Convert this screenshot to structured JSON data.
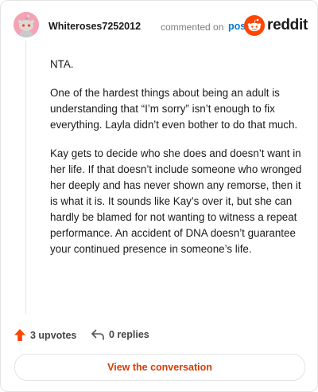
{
  "comment": {
    "username": "Whiteroses7252012",
    "action_text": "commented on",
    "post_link": "post",
    "paragraphs": [
      "NTA.",
      "One of the hardest things about being an adult is understanding that “I’m sorry” isn’t enough to fix everything. Layla didn’t even bother to do that much.",
      "Kay gets to decide who she does and doesn’t want in her life. If that doesn’t include someone who wronged her deeply and has never shown any remorse, then it is what it is. It sounds like Kay’s over it, but she can hardly be blamed for not wanting to witness a repeat performance. An accident of DNA doesn’t guarantee your continued presence in someone’s life."
    ]
  },
  "brand": {
    "wordmark": "reddit",
    "accent": "#ff4500",
    "link_color": "#0079d3"
  },
  "actions": {
    "upvotes": "3 upvotes",
    "replies": "0 replies"
  },
  "footer": {
    "view_label": "View the conversation",
    "view_color": "#d93a00"
  },
  "icons": {
    "avatar": "snoo-avatar",
    "logo": "reddit-alien-icon",
    "upvote": "upvote-arrow-icon",
    "reply": "reply-arrow-icon"
  }
}
